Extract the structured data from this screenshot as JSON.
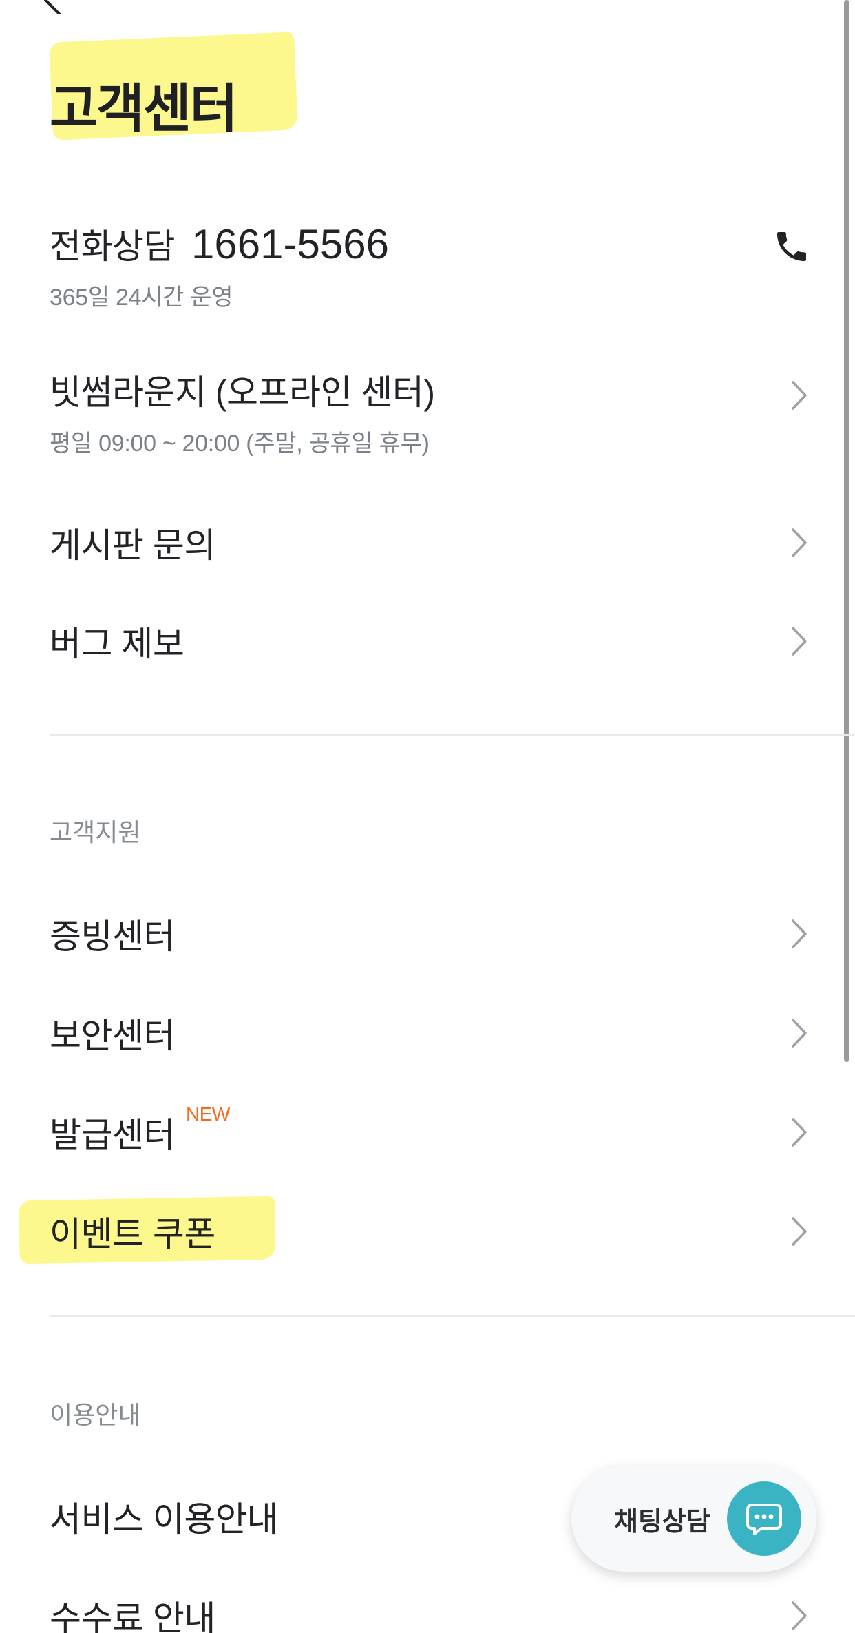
{
  "header": {
    "title": "고객센터"
  },
  "contact": {
    "phone_label": "전화상담",
    "phone_number": "1661-5566",
    "phone_hours": "365일 24시간 운영",
    "lounge_label": "빗썸라운지 (오프라인 센터)",
    "lounge_hours": "평일 09:00 ~ 20:00 (주말, 공휴일 휴무)",
    "board_inquiry": "게시판 문의",
    "bug_report": "버그 제보"
  },
  "support": {
    "section_label": "고객지원",
    "items": [
      {
        "label": "증빙센터"
      },
      {
        "label": "보안센터"
      },
      {
        "label": "발급센터",
        "badge": "NEW"
      },
      {
        "label": "이벤트 쿠폰"
      }
    ]
  },
  "guide": {
    "section_label": "이용안내",
    "items": [
      {
        "label": "서비스 이용안내"
      },
      {
        "label": "수수료 안내"
      }
    ]
  },
  "chat": {
    "label": "채팅상담"
  },
  "icons": {
    "back": "back-chevron-icon",
    "phone": "phone-icon",
    "chevron": "chevron-right-icon",
    "chat": "chat-bubble-icon"
  },
  "colors": {
    "highlight": "#fbf77a",
    "new_badge": "#f26b21",
    "chat_accent": "#3ab4c3"
  }
}
